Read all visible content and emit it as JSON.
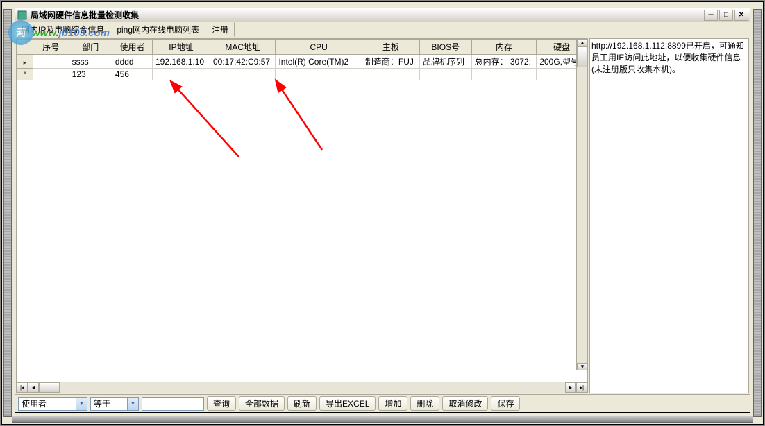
{
  "window": {
    "title": "局域网硬件信息批量检测收集"
  },
  "menu": {
    "items": [
      "网内IP及电脑综合信息",
      "ping网内在线电脑列表",
      "注册"
    ]
  },
  "watermark": {
    "text1": "www.",
    "text2": "jb103.com"
  },
  "columns": [
    "序号",
    "部门",
    "使用者",
    "IP地址",
    "MAC地址",
    "CPU",
    "主板",
    "BIOS号",
    "内存",
    "硬盘"
  ],
  "rows": [
    {
      "seq": "",
      "dept": "ssss",
      "user": "dddd",
      "ip": "192.168.1.10",
      "mac": "00:17:42:C9:57",
      "cpu": "Intel(R) Core(TM)2",
      "mb": "制造商：FUJ",
      "bios": "品牌机序列",
      "mem": "总内存： 3072:",
      "disk": "200G,型号"
    },
    {
      "seq": "",
      "dept": "123",
      "user": "456",
      "ip": "",
      "mac": "",
      "cpu": "",
      "mb": "",
      "bios": "",
      "mem": "",
      "disk": ""
    }
  ],
  "side_text": "http://192.168.1.112:8899已开启，可通知员工用IE访问此地址，以便收集硬件信息(未注册版只收集本机)。",
  "bottombar": {
    "field_combo": "使用者",
    "op_combo": "等于",
    "search_btn": "查询",
    "all_btn": "全部数据",
    "refresh_btn": "刷新",
    "export_btn": "导出EXCEL",
    "add_btn": "增加",
    "delete_btn": "删除",
    "cancel_btn": "取消修改",
    "save_btn": "保存"
  }
}
